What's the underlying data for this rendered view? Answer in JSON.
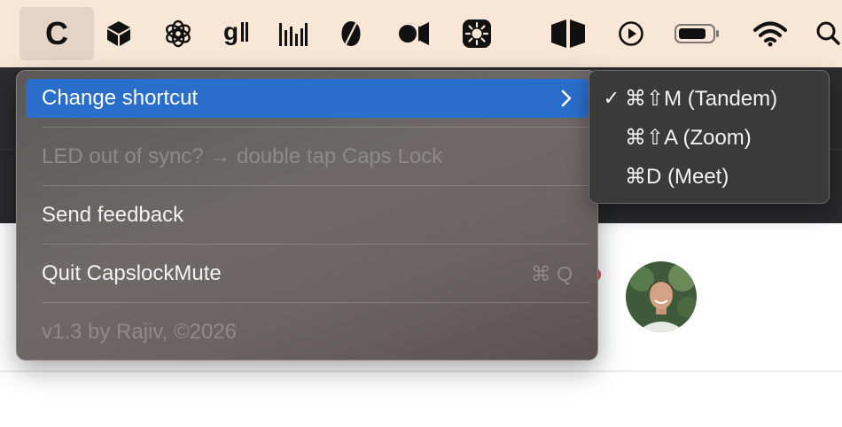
{
  "menubar": {
    "app_letter": "C",
    "icons": [
      "capslockmute-app-icon",
      "box-icon",
      "openai-icon",
      "grammarly-icon",
      "audio-bars-icon",
      "leaf-icon",
      "video-camera-icon",
      "sun-badge-icon",
      "split-panels-icon",
      "play-circle-icon",
      "battery-icon",
      "wifi-icon",
      "search-icon"
    ]
  },
  "menu": {
    "change_shortcut": "Change shortcut",
    "led_hint": "LED out of sync? → double tap Caps Lock",
    "send_feedback": "Send feedback",
    "quit": "Quit CapslockMute",
    "quit_shortcut": "⌘ Q",
    "version": "v1.3 by Rajiv, ©2026"
  },
  "submenu": {
    "items": [
      {
        "label": "⌘⇧M (Tandem)",
        "checked": true,
        "check_mark": "✓"
      },
      {
        "label": "⌘⇧A (Zoom)",
        "checked": false,
        "check_mark": ""
      },
      {
        "label": "⌘D (Meet)",
        "checked": false,
        "check_mark": ""
      }
    ]
  },
  "colors": {
    "menubar_bg": "#f8e6d6",
    "highlight": "#2a6ecb",
    "menu_bg": "#656160",
    "submenu_bg": "#3b3a3a"
  }
}
